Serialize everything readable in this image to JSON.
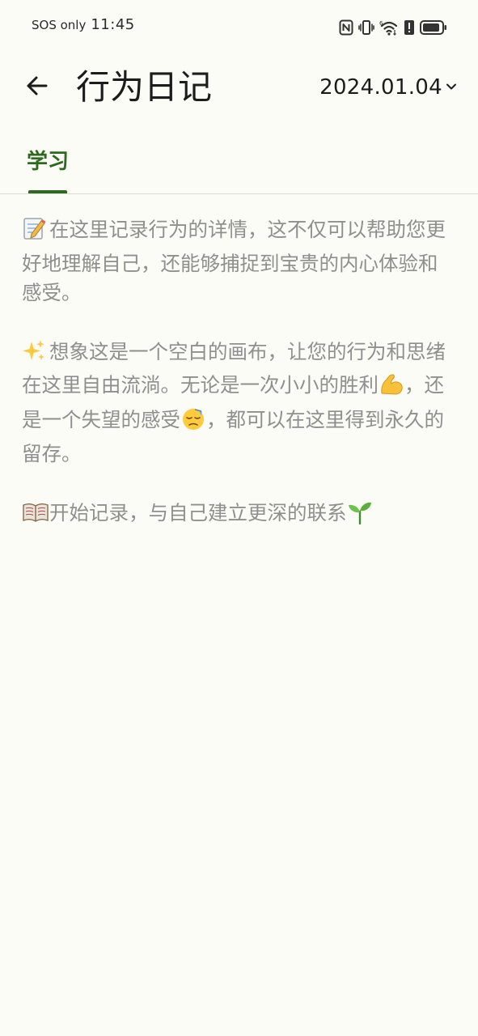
{
  "status_bar": {
    "sos": "SOS only",
    "time": "11:45",
    "icons": [
      "nfc-icon",
      "vibrate-icon",
      "wifi-icon",
      "alert-icon",
      "battery-icon"
    ]
  },
  "app_bar": {
    "title": "行为日记",
    "date": "2024.01.04",
    "back_icon": "arrow-left-icon",
    "dropdown_icon": "chevron-down-icon"
  },
  "tabs": [
    {
      "label": "学习",
      "active": true
    }
  ],
  "content": {
    "p1": {
      "emoji": "memo-icon",
      "text": "在这里记录行为的详情，这不仅可以帮助您更好地理解自己，还能够捕捉到宝贵的内心体验和感受。"
    },
    "p2": {
      "emoji": "sparkles-icon",
      "text_a": "想象这是一个空白的画布，让您的行为和思绪在这里自由流淌。无论是一次小小的胜利",
      "emoji_b": "flexed-biceps-icon",
      "text_b": "，还是一个失望的感受",
      "emoji_c": "downcast-sweat-face-icon",
      "text_c": "，都可以在这里得到永久的留存。"
    },
    "p3": {
      "emoji": "open-book-icon",
      "text": "开始记录，与自己建立更深的联系",
      "emoji_end": "seedling-icon"
    }
  },
  "colors": {
    "background": "#FBFCF6",
    "accent_green": "#2D6A1E",
    "hint_text": "#8F8F8F",
    "title_text": "#1C1C1C"
  }
}
